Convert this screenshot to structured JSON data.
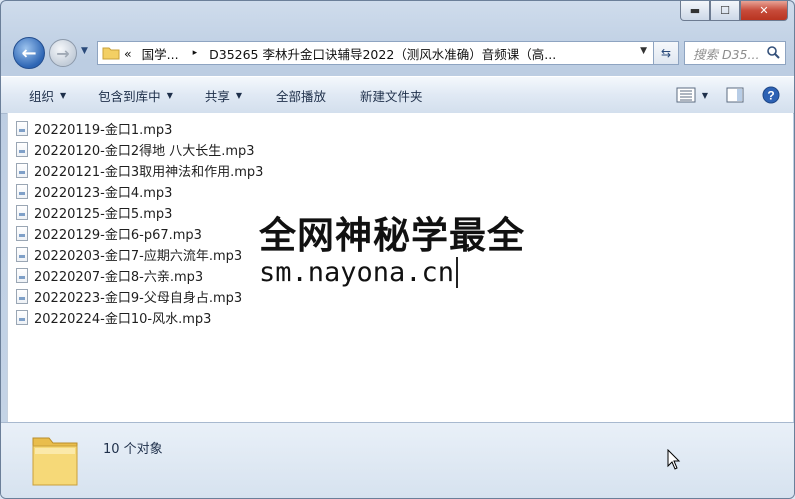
{
  "window": {
    "caption": {
      "minimize": "▬",
      "maximize": "☐",
      "close": "✕"
    }
  },
  "address": {
    "prefix": "«",
    "crumb1": "国学...",
    "sep": "▸",
    "crumb2": "D35265 李林升金口诀辅导2022（测风水准确）音频课（高...",
    "search_placeholder": "搜索 D35..."
  },
  "toolbar": {
    "organize": "组织",
    "include": "包含到库中",
    "share": "共享",
    "play_all": "全部播放",
    "new_folder": "新建文件夹"
  },
  "files": [
    "20220119-金口1.mp3",
    "20220120-金口2得地 八大长生.mp3",
    "20220121-金口3取用神法和作用.mp3",
    "20220123-金口4.mp3",
    "20220125-金口5.mp3",
    "20220129-金口6-p67.mp3",
    "20220203-金口7-应期六流年.mp3",
    "20220207-金口8-六亲.mp3",
    "20220223-金口9-父母自身占.mp3",
    "20220224-金口10-风水.mp3"
  ],
  "watermark": {
    "line1": "全网神秘学最全",
    "line2": "sm.nayona.cn"
  },
  "status": {
    "count": "10 个对象"
  }
}
